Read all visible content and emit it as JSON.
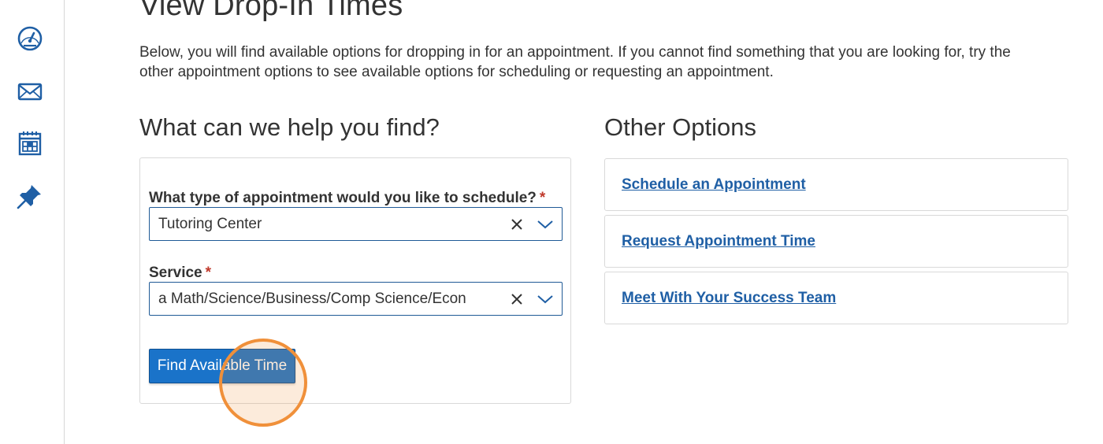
{
  "sidebar": {
    "items": [
      {
        "name": "dashboard",
        "icon": "speedometer-icon"
      },
      {
        "name": "messages",
        "icon": "envelope-icon"
      },
      {
        "name": "calendar",
        "icon": "calendar-icon"
      },
      {
        "name": "pinned",
        "icon": "pushpin-icon"
      }
    ],
    "icon_color": "#1f5fa5"
  },
  "page": {
    "title": "View Drop-In Times",
    "intro": "Below, you will find available options for dropping in for an appointment. If you cannot find something that you are looking for, try the other appointment options to see available options for scheduling or requesting an appointment."
  },
  "form": {
    "heading": "What can we help you find?",
    "appointment_type": {
      "label": "What type of appointment would you like to schedule?",
      "required_mark": "*",
      "value": "Tutoring Center"
    },
    "service": {
      "label": "Service",
      "required_mark": "*",
      "value": "a Math/Science/Business/Comp Science/Econ"
    },
    "submit_label": "Find Available Time"
  },
  "other_options": {
    "heading": "Other Options",
    "links": [
      {
        "label": "Schedule an Appointment"
      },
      {
        "label": "Request Appointment Time"
      },
      {
        "label": "Meet With Your Success Team"
      }
    ]
  },
  "colors": {
    "accent": "#1a73c9",
    "link": "#1f5fa5",
    "required": "#c0392b",
    "highlight": "#f0903a"
  }
}
